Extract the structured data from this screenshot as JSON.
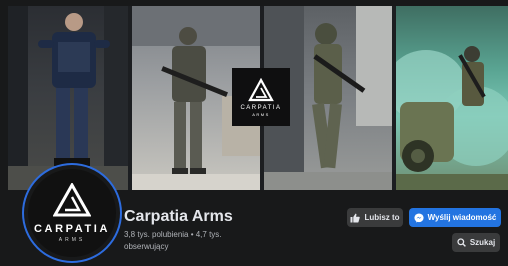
{
  "page": {
    "name": "Carpatia Arms",
    "stats": "3,8 tys. polubienia • 4,7 tys. obserwujący"
  },
  "cover": {
    "logo_word": "CARPATIA",
    "logo_sub": "ARMS"
  },
  "avatar": {
    "brand": "CARPATIA",
    "sub": "ARMS"
  },
  "buttons": {
    "like": "Lubisz to",
    "message": "Wyślij wiadomość",
    "search": "Szukaj"
  },
  "colors": {
    "background": "#18191a",
    "accent": "#2374e1",
    "secondary_button": "#3a3b3c"
  },
  "icons": {
    "like": "thumbs-up-icon",
    "message": "messenger-icon",
    "search": "search-icon"
  }
}
